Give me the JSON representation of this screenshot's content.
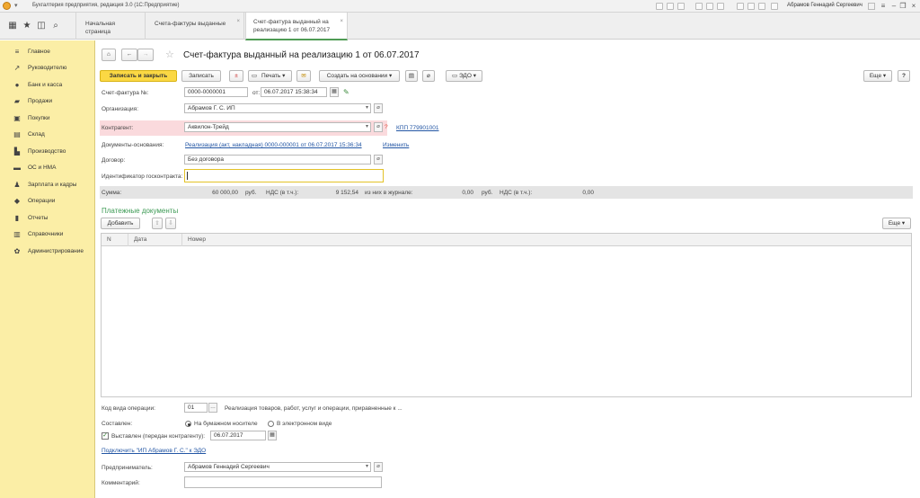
{
  "window": {
    "title": "Бухгалтерия предприятия, редакция 3.0  (1С:Предприятие)",
    "user": "Абрамов Геннадий Сергеевич"
  },
  "tabs": [
    {
      "label": "Начальная страница"
    },
    {
      "label": "Счета-фактуры выданные"
    },
    {
      "label": "Счет-фактура выданный на реализацию 1 от 06.07.2017"
    }
  ],
  "sidebar": {
    "items": [
      {
        "label": "Главное",
        "icon": "menu-icon"
      },
      {
        "label": "Руководителю",
        "icon": "chart-line-icon"
      },
      {
        "label": "Банк и касса",
        "icon": "bank-icon"
      },
      {
        "label": "Продажи",
        "icon": "sales-icon"
      },
      {
        "label": "Покупки",
        "icon": "cart-icon"
      },
      {
        "label": "Склад",
        "icon": "warehouse-icon"
      },
      {
        "label": "Производство",
        "icon": "factory-icon"
      },
      {
        "label": "ОС и НМА",
        "icon": "truck-icon"
      },
      {
        "label": "Зарплата и кадры",
        "icon": "person-icon"
      },
      {
        "label": "Операции",
        "icon": "operations-icon"
      },
      {
        "label": "Отчеты",
        "icon": "bar-chart-icon"
      },
      {
        "label": "Справочники",
        "icon": "books-icon"
      },
      {
        "label": "Администрирование",
        "icon": "gear-icon"
      }
    ]
  },
  "form": {
    "title": "Счет-фактура выданный на реализацию 1 от 06.07.2017",
    "toolbar": {
      "save_close": "Записать и закрыть",
      "save": "Записать",
      "print": "Печать",
      "create_based": "Создать на основании",
      "edo": "ЭДО",
      "more": "Еще",
      "help": "?"
    },
    "number_label": "Счет-фактура №:",
    "number_value": "0000-0000001",
    "from_label": "от:",
    "date_value": "06.07.2017 15:38:34",
    "org_label": "Организация:",
    "org_value": "Абрамов Г. С. ИП",
    "counterparty_label": "Контрагент:",
    "counterparty_value": "Аквилон-Трейд",
    "kpp_link": "КПП 779901001",
    "basis_label": "Документы-основания:",
    "basis_link": "Реализация (акт, накладная) 0000-000001 от 06.07.2017 15:36:34",
    "change_link": "Изменить",
    "contract_label": "Договор:",
    "contract_value": "Без договора",
    "gov_label": "Идентификатор госконтракта:",
    "gov_value": "",
    "sum_label": "Сумма:",
    "sum_value": "60 000,00",
    "rub1": "руб.",
    "vat_label": "НДС (в т.ч.):",
    "vat_value": "9 152,54",
    "journal_label": "из них в журнале:",
    "journal_value": "0,00",
    "rub2": "руб.",
    "vat2_label": "НДС (в т.ч.):",
    "vat2_value": "0,00",
    "payments_title": "Платежные документы",
    "add_btn": "Добавить",
    "more2": "Еще",
    "columns": [
      "N",
      "Дата",
      "Номер"
    ],
    "op_code_label": "Код вида операции:",
    "op_code_value": "01",
    "op_code_desc": "Реализация товаров, работ, услуг и операции, приравненные к ...",
    "composed_label": "Составлен:",
    "paper_label": "На бумажном носителе",
    "electronic_label": "В электронном виде",
    "issued_label": "Выставлен (передан контрагенту):",
    "issued_date": "06.07.2017",
    "connect_link": "Подключить \"ИП Абрамов Г. С.\" к ЭДО",
    "entrepreneur_label": "Предприниматель:",
    "entrepreneur_value": "Абрамов Геннадий Сергеевич",
    "comment_label": "Комментарий:",
    "comment_value": ""
  },
  "colors": {
    "sidebar": "#fbeea6",
    "primary_button": "#fbd844",
    "link": "#2356a4",
    "section_title": "#3c9a54",
    "error_bg": "#fadadd"
  }
}
